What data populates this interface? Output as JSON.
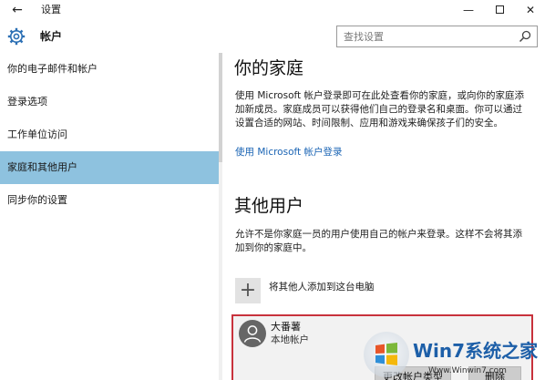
{
  "window": {
    "title": "设置",
    "back_glyph": "←",
    "minimize_glyph": "—",
    "close_glyph": "✕"
  },
  "header": {
    "section_title": "帐户",
    "search": {
      "placeholder": "查找设置"
    }
  },
  "sidebar": {
    "items": [
      {
        "label": "你的电子邮件和帐户",
        "active": false
      },
      {
        "label": "登录选项",
        "active": false
      },
      {
        "label": "工作单位访问",
        "active": false
      },
      {
        "label": "家庭和其他用户",
        "active": true
      },
      {
        "label": "同步你的设置",
        "active": false
      }
    ]
  },
  "main": {
    "family": {
      "heading": "你的家庭",
      "description": "使用 Microsoft 帐户登录即可在此处查看你的家庭，或向你的家庭添加新成员。家庭成员可以获得他们自己的登录名和桌面。你可以通过设置合适的网站、时间限制、应用和游戏来确保孩子们的安全。",
      "signin_link": "使用 Microsoft 帐户登录"
    },
    "other_users": {
      "heading": "其他用户",
      "description": "允许不是你家庭一员的用户使用自己的帐户来登录。这样不会将其添加到你的家庭中。",
      "add_label": "将其他人添加到这台电脑",
      "add_glyph": "+",
      "user": {
        "name": "大番薯",
        "account_type": "本地帐户",
        "change_type_button": "更改帐户类型",
        "remove_button": "删除"
      }
    }
  },
  "watermark": {
    "brand": "Win7系统之家",
    "url": "Www.Winwin7.com"
  },
  "colors": {
    "accent": "#8ec2df",
    "link": "#1a64b4",
    "highlight_border": "#c8323c",
    "gear": "#2b6fb4"
  }
}
